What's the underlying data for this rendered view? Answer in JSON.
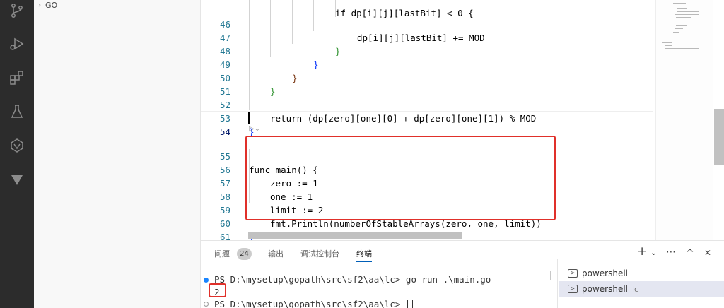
{
  "sidebar": {
    "folder_label": "GO"
  },
  "editor": {
    "lines": [
      {
        "n": "46",
        "text": "dp[i][j][lastBit] += MOD"
      },
      {
        "n": "47",
        "text": "}"
      },
      {
        "n": "48",
        "text": "}"
      },
      {
        "n": "49",
        "text": "}"
      },
      {
        "n": "50",
        "text": "}"
      },
      {
        "n": "51",
        "text": ""
      },
      {
        "n": "52",
        "text": "return (dp[zero][one][0] + dp[zero][one][1]) % MOD"
      },
      {
        "n": "53",
        "text": "}"
      },
      {
        "n": "54",
        "text": ""
      },
      {
        "n": "55",
        "text": "func main() {"
      },
      {
        "n": "56",
        "text": "zero := 1"
      },
      {
        "n": "57",
        "text": "one := 1"
      },
      {
        "n": "58",
        "text": "limit := 2"
      },
      {
        "n": "59",
        "text": "fmt.Println(numberOfStableArrays(zero, one, limit))"
      },
      {
        "n": "60",
        "text": "}"
      },
      {
        "n": "61",
        "text": ""
      }
    ],
    "partial_top_line": "if dp[i][j][lastBit] < 0 {"
  },
  "panel": {
    "tabs": [
      {
        "label": "问题",
        "badge": "24"
      },
      {
        "label": "输出"
      },
      {
        "label": "调试控制台"
      },
      {
        "label": "终端",
        "active": true
      }
    ],
    "toolbar": {
      "add": "+",
      "dropdown": "⌄",
      "more": "⋯",
      "maximize": "^",
      "close": "✕"
    },
    "terminal": {
      "prompt1": "PS D:\\mysetup\\gopath\\src\\sf2\\aa\\lc> go run .\\main.go",
      "output": "2",
      "prompt2": "PS D:\\mysetup\\gopath\\src\\sf2\\aa\\lc> "
    },
    "terminal_list": [
      {
        "label": "powershell",
        "sub": ""
      },
      {
        "label": "powershell",
        "sub": "lc"
      }
    ]
  },
  "colors": {
    "activity_bar": "#2c2c2c",
    "highlight_border": "#e0302a",
    "accent": "#005fb8"
  }
}
